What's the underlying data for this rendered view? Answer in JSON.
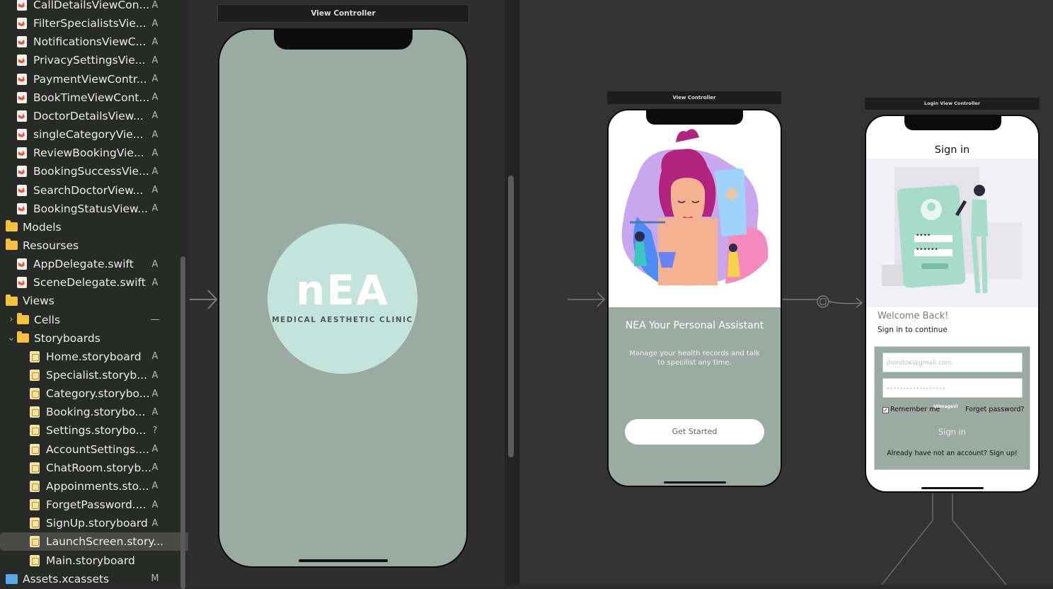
{
  "navigator": {
    "files": [
      {
        "name": "CallDetailsViewCon...",
        "status": "A",
        "icon": "swift-file-icon",
        "indent": 1
      },
      {
        "name": "FilterSpecialistsVie...",
        "status": "A",
        "icon": "swift-file-icon",
        "indent": 1
      },
      {
        "name": "NotificationsViewC...",
        "status": "A",
        "icon": "swift-file-icon",
        "indent": 1
      },
      {
        "name": "PrivacySettingsVie...",
        "status": "A",
        "icon": "swift-file-icon",
        "indent": 1
      },
      {
        "name": "PaymentViewContr...",
        "status": "A",
        "icon": "swift-file-icon",
        "indent": 1
      },
      {
        "name": "BookTimeViewCont...",
        "status": "A",
        "icon": "swift-file-icon",
        "indent": 1
      },
      {
        "name": "DoctorDetailsView...",
        "status": "A",
        "icon": "swift-file-icon",
        "indent": 1
      },
      {
        "name": "singleCategoryVie...",
        "status": "A",
        "icon": "swift-file-icon",
        "indent": 1
      },
      {
        "name": "ReviewBookingVie...",
        "status": "A",
        "icon": "swift-file-icon",
        "indent": 1
      },
      {
        "name": "BookingSuccessVie...",
        "status": "A",
        "icon": "swift-file-icon",
        "indent": 1
      },
      {
        "name": "SearchDoctorView...",
        "status": "A",
        "icon": "swift-file-icon",
        "indent": 1
      },
      {
        "name": "BookingStatusView...",
        "status": "A",
        "icon": "swift-file-icon",
        "indent": 1
      },
      {
        "name": "Models",
        "status": "",
        "icon": "folder-icon",
        "indent": 0
      },
      {
        "name": "Resourses",
        "status": "",
        "icon": "folder-icon",
        "indent": 0
      },
      {
        "name": "AppDelegate.swift",
        "status": "A",
        "icon": "swift-file-icon",
        "indent": 1
      },
      {
        "name": "SceneDelegate.swift",
        "status": "A",
        "icon": "swift-file-icon",
        "indent": 1
      },
      {
        "name": "Views",
        "status": "",
        "icon": "folder-icon",
        "indent": 0
      },
      {
        "name": "Cells",
        "status": "—",
        "icon": "folder-icon",
        "indent": 1,
        "chevron": "›"
      },
      {
        "name": "Storyboards",
        "status": "",
        "icon": "folder-icon",
        "indent": 1,
        "chevron": "⌄"
      },
      {
        "name": "Home.storyboard",
        "status": "A",
        "icon": "storyboard-file-icon",
        "indent": 2
      },
      {
        "name": "Specialist.storyb...",
        "status": "A",
        "icon": "storyboard-file-icon",
        "indent": 2
      },
      {
        "name": "Category.storybo...",
        "status": "A",
        "icon": "storyboard-file-icon",
        "indent": 2
      },
      {
        "name": "Booking.storybo...",
        "status": "A",
        "icon": "storyboard-file-icon",
        "indent": 2
      },
      {
        "name": "Settings.storybo...",
        "status": "?",
        "icon": "storyboard-file-icon",
        "indent": 2
      },
      {
        "name": "AccountSettings....",
        "status": "A",
        "icon": "storyboard-file-icon",
        "indent": 2
      },
      {
        "name": "ChatRoom.storyb...",
        "status": "A",
        "icon": "storyboard-file-icon",
        "indent": 2
      },
      {
        "name": "Appoinments.sto...",
        "status": "A",
        "icon": "storyboard-file-icon",
        "indent": 2
      },
      {
        "name": "ForgetPassword....",
        "status": "A",
        "icon": "storyboard-file-icon",
        "indent": 2
      },
      {
        "name": "SignUp.storyboard",
        "status": "A",
        "icon": "storyboard-file-icon",
        "indent": 2
      },
      {
        "name": "LaunchScreen.story...",
        "status": "",
        "icon": "storyboard-file-icon",
        "indent": 2,
        "selected": true
      },
      {
        "name": "Main.storyboard",
        "status": "",
        "icon": "storyboard-file-icon",
        "indent": 2
      },
      {
        "name": "Assets.xcassets",
        "status": "M",
        "icon": "asset-catalog-icon",
        "indent": 0
      }
    ]
  },
  "launch_scene": {
    "title": "View Controller",
    "logo_text": "nEA",
    "logo_subtitle": "MEDICAL AESTHETIC CLINIC",
    "bg_color": "#9aaba4",
    "circle_color": "#c4e4db"
  },
  "onboard_scene": {
    "title": "View Controller",
    "heading": "NEA Your Personal Assistant",
    "body": "Manage your health records and talk to specilist any time.",
    "button": "Get Started"
  },
  "login_scene": {
    "title": "Login View Controller",
    "header": "Sign in",
    "welcome": "Welcome Back!",
    "subtitle": "Sign in to continue",
    "email_placeholder": "jhondoe@gmail.com",
    "password_placeholder": "••••••••••••••••••",
    "remember": "Remember me",
    "forgot": "Forget password?",
    "signin_button": "Sign in",
    "signup_prompt": "Already have not an account? Sign up!",
    "illustration_masked_1": "••••",
    "illustration_masked_2": "••••••",
    "overlay_label": "UIImageVi"
  },
  "colors": {
    "scene_gray": "#9aaba4",
    "accent_mint": "#c4e4db"
  }
}
